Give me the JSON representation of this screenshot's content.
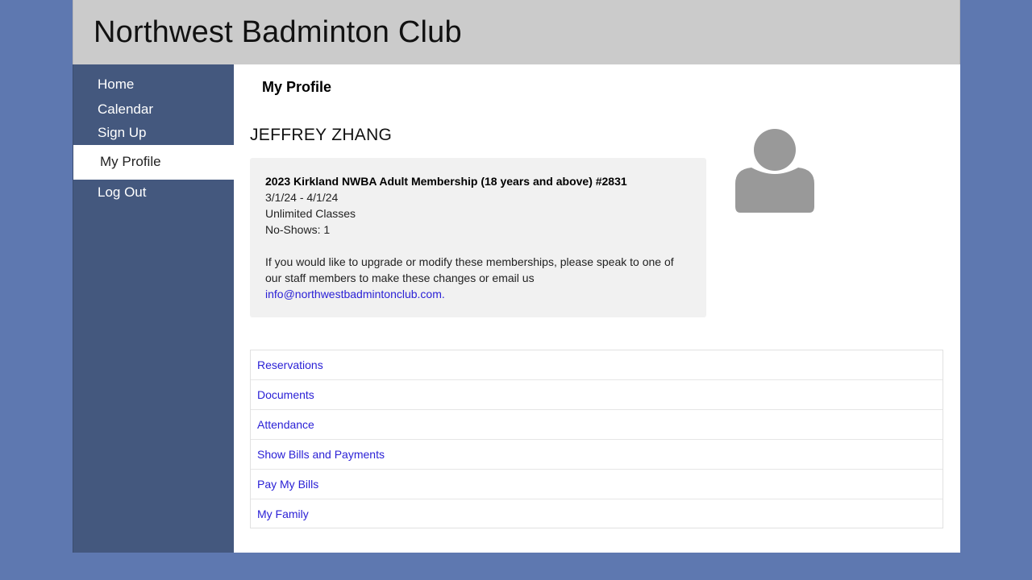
{
  "header": {
    "title": "Northwest Badminton Club"
  },
  "sidebar": {
    "items": [
      {
        "label": "Home"
      },
      {
        "label": "Calendar"
      },
      {
        "label": "Sign Up"
      },
      {
        "label": "My Profile",
        "active": true
      },
      {
        "label": "Log Out"
      }
    ]
  },
  "main": {
    "page_title": "My Profile",
    "member_name": "JEFFREY ZHANG",
    "membership": {
      "title": "2023 Kirkland NWBA Adult Membership (18 years and above) #2831",
      "dates": "3/1/24 - 4/1/24",
      "classes": "Unlimited Classes",
      "no_shows": "No-Shows: 1",
      "note": "If you would like to upgrade or modify these memberships, please speak to one of our staff members to make these changes or email us",
      "email": "info@northwestbadmintonclub.com."
    },
    "links": [
      {
        "label": "Reservations"
      },
      {
        "label": "Documents"
      },
      {
        "label": "Attendance"
      },
      {
        "label": "Show Bills and Payments"
      },
      {
        "label": "Pay My Bills"
      },
      {
        "label": "My Family"
      }
    ]
  },
  "colors": {
    "background": "#5e78b0",
    "sidebar": "#44587e",
    "header": "#cbcbcb",
    "link": "#2b21d6",
    "avatar": "#999999"
  },
  "icons": {
    "avatar": "user-silhouette-icon"
  }
}
